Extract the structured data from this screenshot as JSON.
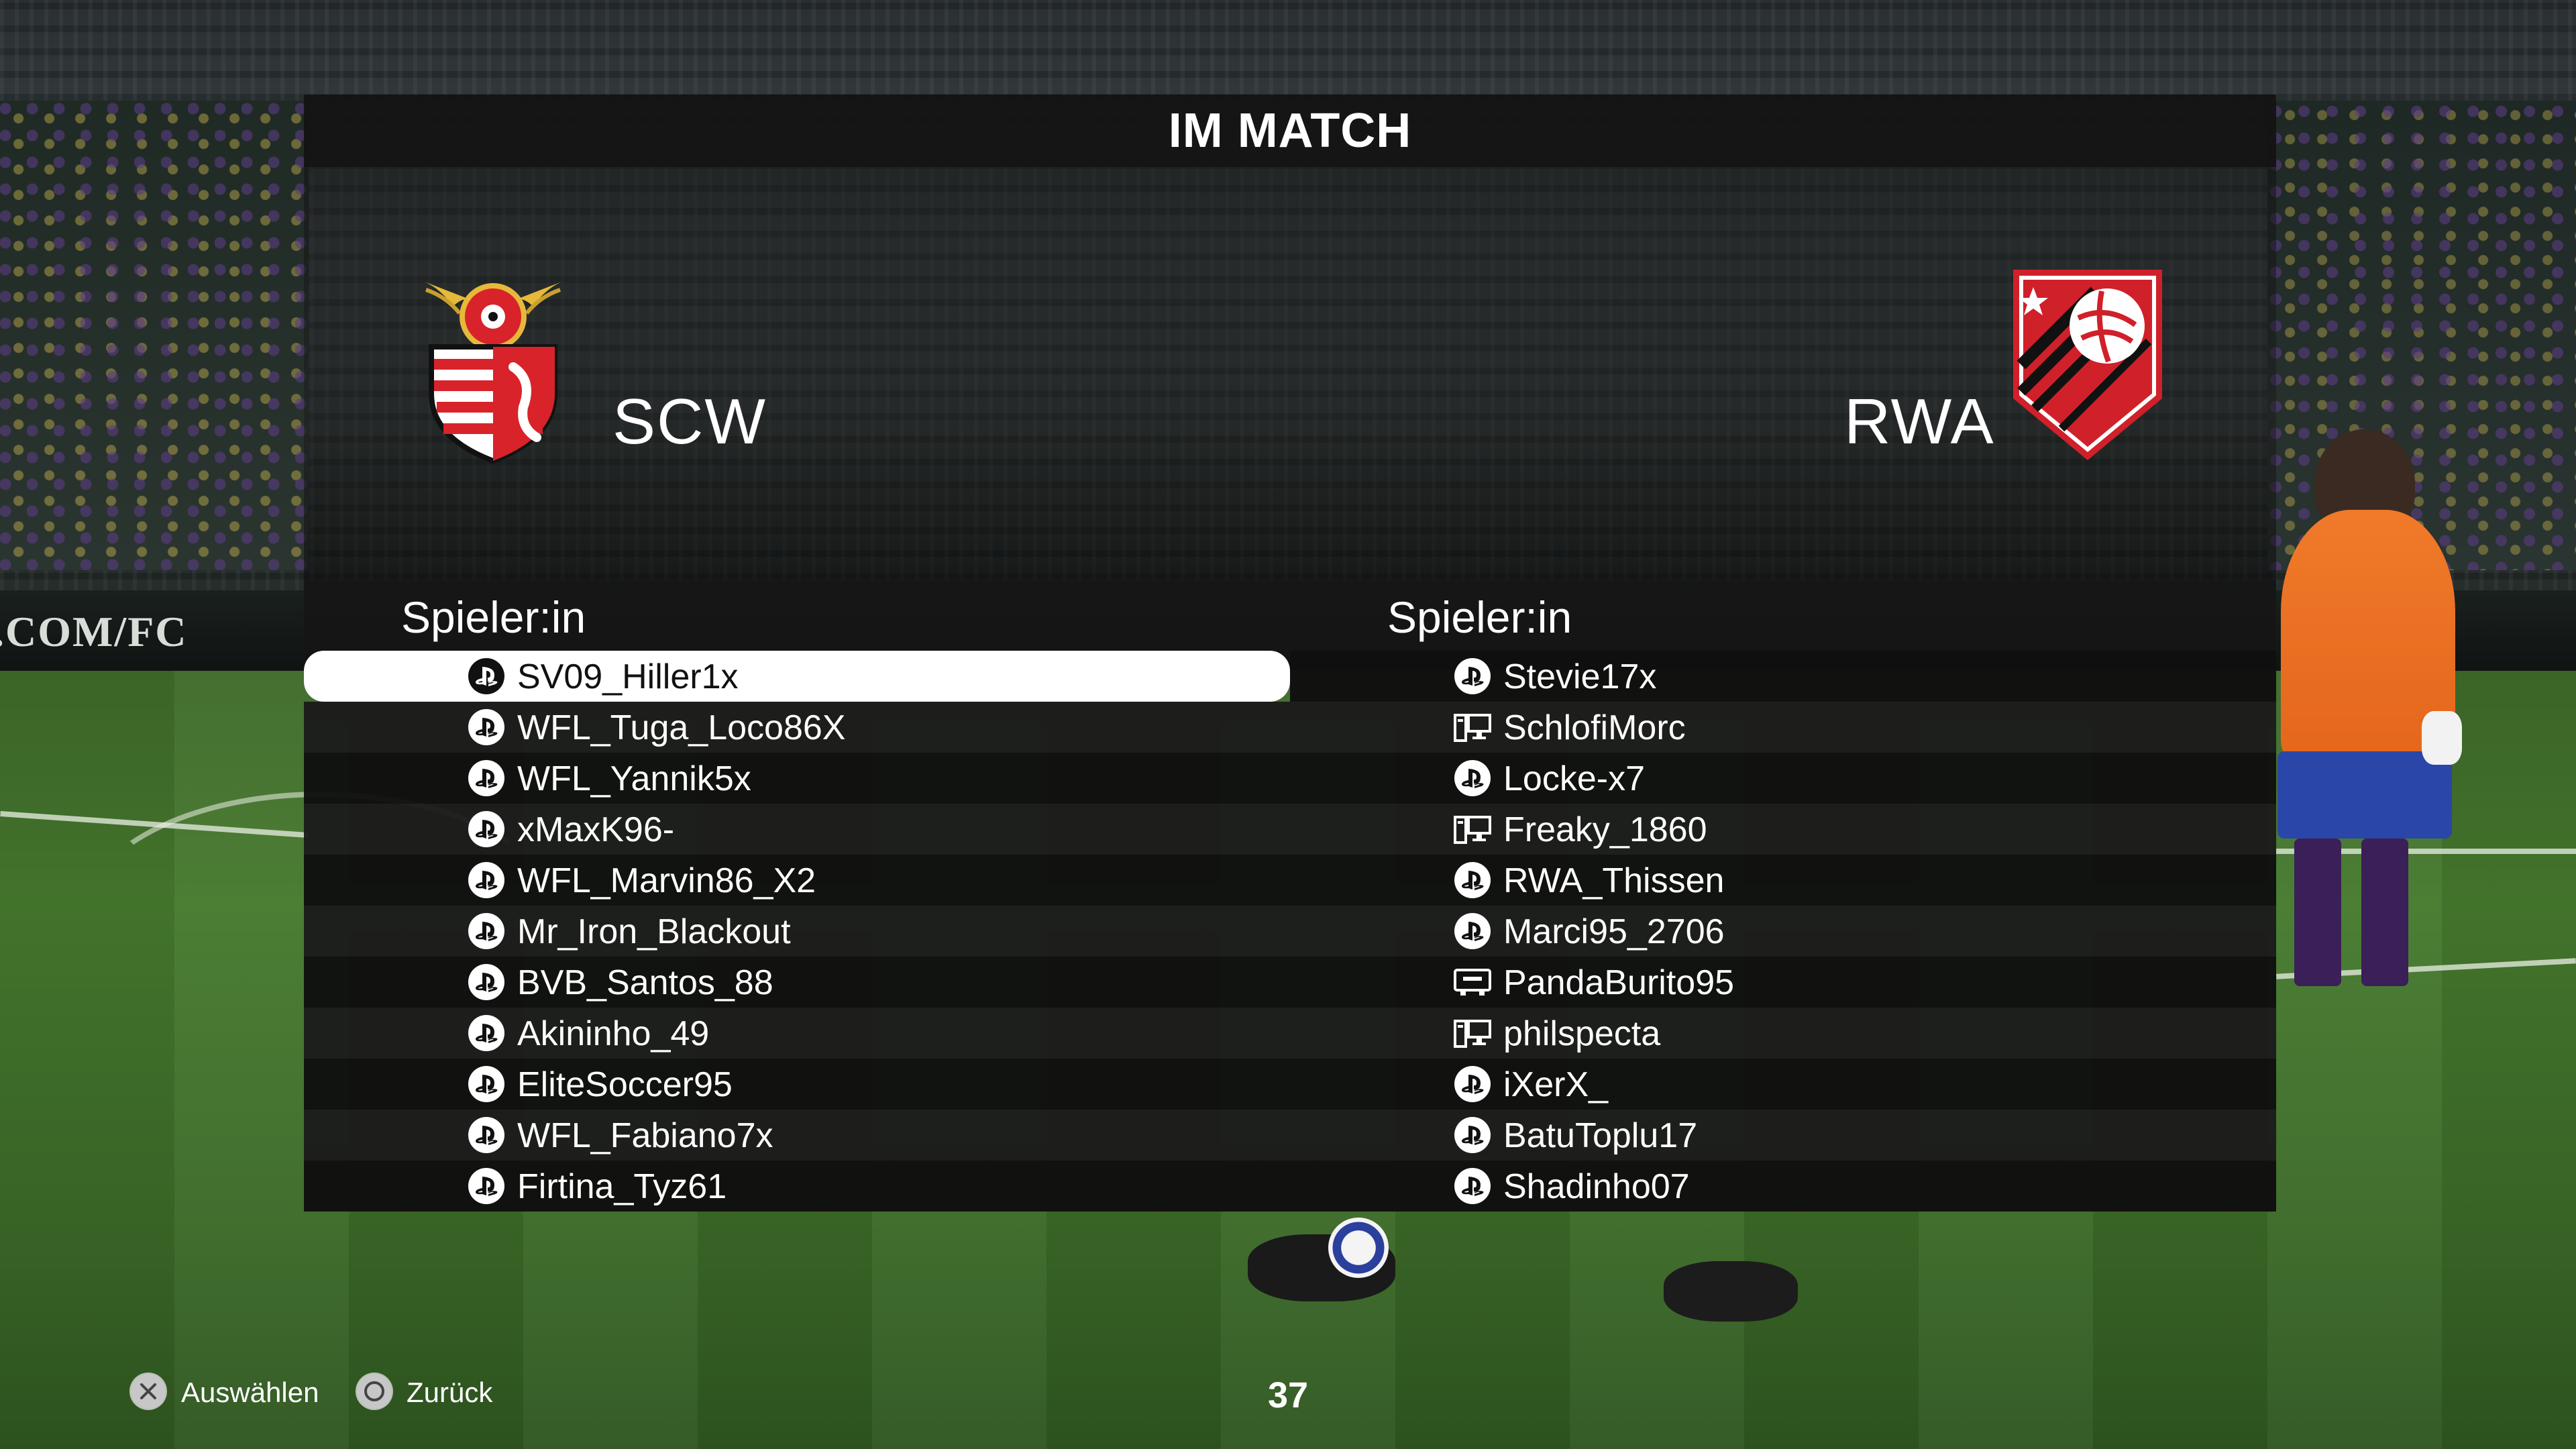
{
  "screen": {
    "title": "IM MATCH"
  },
  "background": {
    "board_text": ".COM/FC"
  },
  "teams": {
    "left": {
      "name": "SCW",
      "column_label": "Spieler:in"
    },
    "right": {
      "name": "RWA",
      "column_label": "Spieler:in"
    }
  },
  "players_left": [
    {
      "name": "SV09_Hiller1x",
      "platform": "playstation-icon",
      "selected": true
    },
    {
      "name": "WFL_Tuga_Loco86X",
      "platform": "playstation-icon"
    },
    {
      "name": "WFL_Yannik5x",
      "platform": "playstation-icon"
    },
    {
      "name": "xMaxK96-",
      "platform": "playstation-icon"
    },
    {
      "name": "WFL_Marvin86_X2",
      "platform": "playstation-icon"
    },
    {
      "name": "Mr_Iron_Blackout",
      "platform": "playstation-icon"
    },
    {
      "name": "BVB_Santos_88",
      "platform": "playstation-icon"
    },
    {
      "name": "Akininho_49",
      "platform": "playstation-icon"
    },
    {
      "name": "EliteSoccer95",
      "platform": "playstation-icon"
    },
    {
      "name": "WFL_Fabiano7x",
      "platform": "playstation-icon"
    },
    {
      "name": "Firtina_Tyz61",
      "platform": "playstation-icon"
    }
  ],
  "players_right": [
    {
      "name": "Stevie17x",
      "platform": "playstation-icon"
    },
    {
      "name": "SchlofiMorc",
      "platform": "pc-icon"
    },
    {
      "name": "Locke-x7",
      "platform": "playstation-icon"
    },
    {
      "name": "Freaky_1860",
      "platform": "pc-icon"
    },
    {
      "name": "RWA_Thissen",
      "platform": "playstation-icon"
    },
    {
      "name": "Marci95_2706",
      "platform": "playstation-icon"
    },
    {
      "name": "PandaBurito95",
      "platform": "xbox-console-icon"
    },
    {
      "name": "philspecta",
      "platform": "pc-icon"
    },
    {
      "name": "iXerX_",
      "platform": "playstation-icon"
    },
    {
      "name": "BatuToplu17",
      "platform": "playstation-icon"
    },
    {
      "name": "Shadinho07",
      "platform": "playstation-icon"
    }
  ],
  "footer": {
    "select_label": "Auswählen",
    "select_icon": "cross-button-icon",
    "back_label": "Zurück",
    "back_icon": "circle-button-icon",
    "timer": "37"
  },
  "colors": {
    "selection": "#ffffff",
    "panel": "#141414",
    "rwa_red": "#d0202a",
    "scw_red": "#d8232a",
    "scw_gold": "#e6b93a"
  }
}
